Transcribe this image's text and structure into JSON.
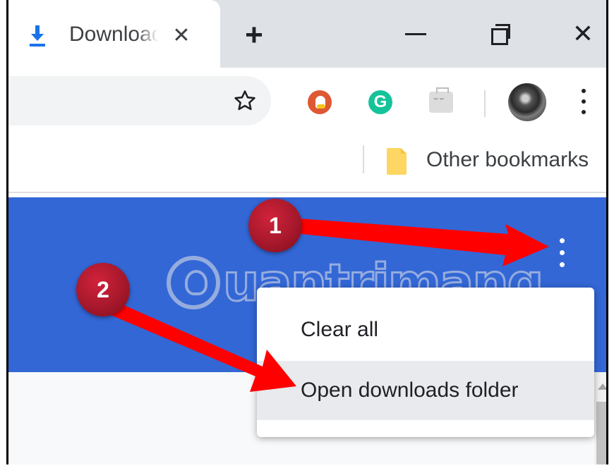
{
  "tab": {
    "title": "Downloads",
    "close_glyph": "✕",
    "icon": "download-icon"
  },
  "tabstrip": {
    "new_tab_glyph": "+",
    "minimize_icon": "minimize-icon",
    "maximize_icon": "restore-icon",
    "close_glyph": "✕"
  },
  "toolbar": {
    "bookmark_star_icon": "star-outline-icon",
    "extensions": [
      {
        "name": "duckduckgo",
        "icon": "duckduckgo-icon"
      },
      {
        "name": "grammarly",
        "label": "G",
        "icon": "grammarly-icon"
      },
      {
        "name": "extension-box",
        "icon": "box-face-icon"
      }
    ],
    "avatar_icon": "profile-avatar",
    "menu_icon": "vertical-dots-icon"
  },
  "bookmarks_bar": {
    "folder_icon": "folder-icon",
    "label": "Other bookmarks"
  },
  "downloads_page": {
    "header_color": "#3367d6",
    "menu_icon": "vertical-dots-icon",
    "context_menu": {
      "items": [
        {
          "label": "Clear all"
        },
        {
          "label": "Open downloads folder",
          "highlighted": true
        }
      ]
    }
  },
  "watermark": {
    "text": "uantrimang"
  },
  "annotations": {
    "badges": [
      {
        "label": "1"
      },
      {
        "label": "2"
      }
    ],
    "arrow_color": "#ff0000",
    "badge_color": "#b01b2e"
  }
}
